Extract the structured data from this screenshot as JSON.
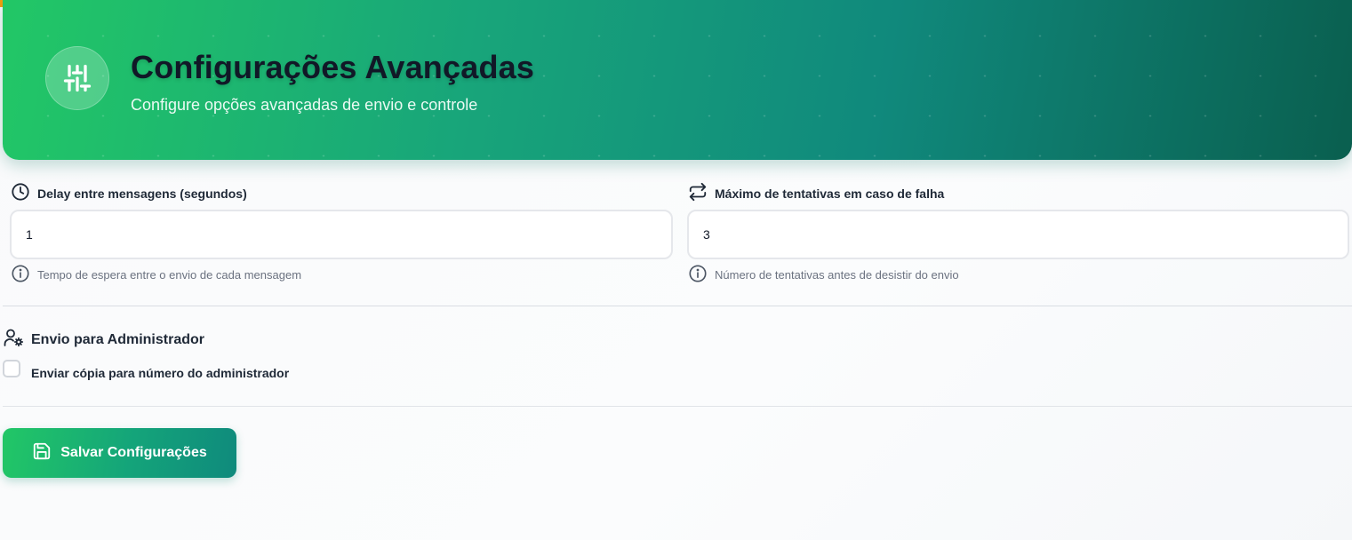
{
  "header": {
    "title": "Configurações Avançadas",
    "subtitle": "Configure opções avançadas de envio e controle",
    "icon": "sliders-icon"
  },
  "fields": {
    "delay": {
      "label": "Delay entre mensagens (segundos)",
      "value": "1",
      "help": "Tempo de espera entre o envio de cada mensagem",
      "icon": "clock-icon"
    },
    "retries": {
      "label": "Máximo de tentativas em caso de falha",
      "value": "3",
      "help": "Número de tentativas antes de desistir do envio",
      "icon": "repeat-icon"
    }
  },
  "admin": {
    "section_title": "Envio para Administrador",
    "checkbox_label": "Enviar cópia para número do administrador",
    "checked": false,
    "icon": "user-cog-icon"
  },
  "actions": {
    "save_label": "Salvar Configurações",
    "save_icon": "save-icon"
  },
  "colors": {
    "accent_start": "#22c766",
    "accent_end": "#0a5f4f",
    "text": "#1f2937",
    "muted": "#6b7280"
  }
}
